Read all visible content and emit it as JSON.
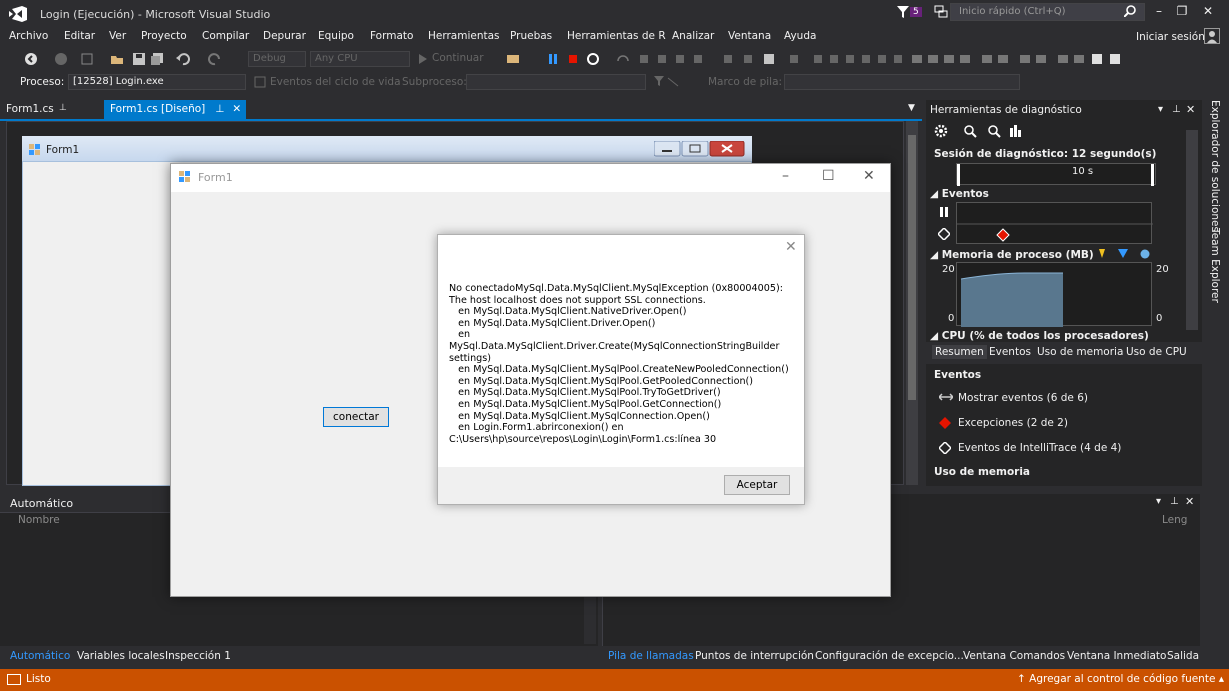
{
  "window": {
    "title": "Login (Ejecución) - Microsoft Visual Studio",
    "quick_launch_placeholder": "Inicio rápido (Ctrl+Q)",
    "notifications_count": "5",
    "sign_in": "Iniciar sesión"
  },
  "menu": [
    "Archivo",
    "Editar",
    "Ver",
    "Proyecto",
    "Compilar",
    "Depurar",
    "Equipo",
    "Formato",
    "Herramientas",
    "Pruebas",
    "Herramientas de R",
    "Analizar",
    "Ventana",
    "Ayuda"
  ],
  "toolbar": {
    "config": "Debug",
    "platform": "Any CPU",
    "continue": "Continuar"
  },
  "toolbar2": {
    "process_label": "Proceso:",
    "process_value": "[12528] Login.exe",
    "lifecycle_events": "Eventos del ciclo de vida",
    "subprocess": "Subproceso:",
    "stack_frame": "Marco de pila:"
  },
  "doc_tabs": [
    {
      "label": "Form1.cs"
    },
    {
      "label": "Form1.cs [Diseño]",
      "active": true
    }
  ],
  "designer": {
    "form_caption": "Form1"
  },
  "form1": {
    "title": "Form1",
    "button_label": "conectar"
  },
  "message_box": {
    "text": "No conectadoMySql.Data.MySqlClient.MySqlException (0x80004005):\nThe host localhost does not support SSL connections.\n   en MySql.Data.MySqlClient.NativeDriver.Open()\n   en MySql.Data.MySqlClient.Driver.Open()\n   en\nMySql.Data.MySqlClient.Driver.Create(MySqlConnectionStringBuilder\nsettings)\n   en MySql.Data.MySqlClient.MySqlPool.CreateNewPooledConnection()\n   en MySql.Data.MySqlClient.MySqlPool.GetPooledConnection()\n   en MySql.Data.MySqlClient.MySqlPool.TryToGetDriver()\n   en MySql.Data.MySqlClient.MySqlPool.GetConnection()\n   en MySql.Data.MySqlClient.MySqlConnection.Open()\n   en Login.Form1.abrirconexion() en\nC:\\Users\\hp\\source\\repos\\Login\\Login\\Form1.cs:línea 30",
    "ok_label": "Aceptar"
  },
  "diagnostics": {
    "title": "Herramientas de diagnóstico",
    "session": "Sesión de diagnóstico: 12 segundo(s)",
    "timeline_label": "10 s",
    "events_header": "Eventos",
    "memory_header": "Memoria de proceso (MB)",
    "memory_max_left": "20",
    "memory_max_right": "20",
    "memory_min_left": "0",
    "memory_min_right": "0",
    "cpu_header": "CPU (% de todos los procesadores)",
    "tabs": [
      "Resumen",
      "Eventos",
      "Uso de memoria",
      "Uso de CPU"
    ],
    "events_section": "Eventos",
    "rows": [
      "Mostrar eventos (6 de 6)",
      "Excepciones (2 de 2)",
      "Eventos de IntelliTrace (4 de 4)"
    ],
    "memory_section": "Uso de memoria"
  },
  "side_rail": [
    "Explorador de soluciones",
    "Team Explorer"
  ],
  "auto_panel": {
    "title": "Automático",
    "column_name": "Nombre",
    "column_len": "Leng"
  },
  "bottom_tabs_left": [
    "Automático",
    "Variables locales",
    "Inspección 1"
  ],
  "bottom_tabs_right": [
    "Pila de llamadas",
    "Puntos de interrupción",
    "Configuración de excepcio...",
    "Ventana Comandos",
    "Ventana Inmediato",
    "Salida"
  ],
  "status": {
    "text": "Listo",
    "source_control": "↑ Agregar al control de código fuente ▴"
  },
  "colors": {
    "accent": "#007acc",
    "status_bar": "#ca5100",
    "exception": "#e51400"
  }
}
